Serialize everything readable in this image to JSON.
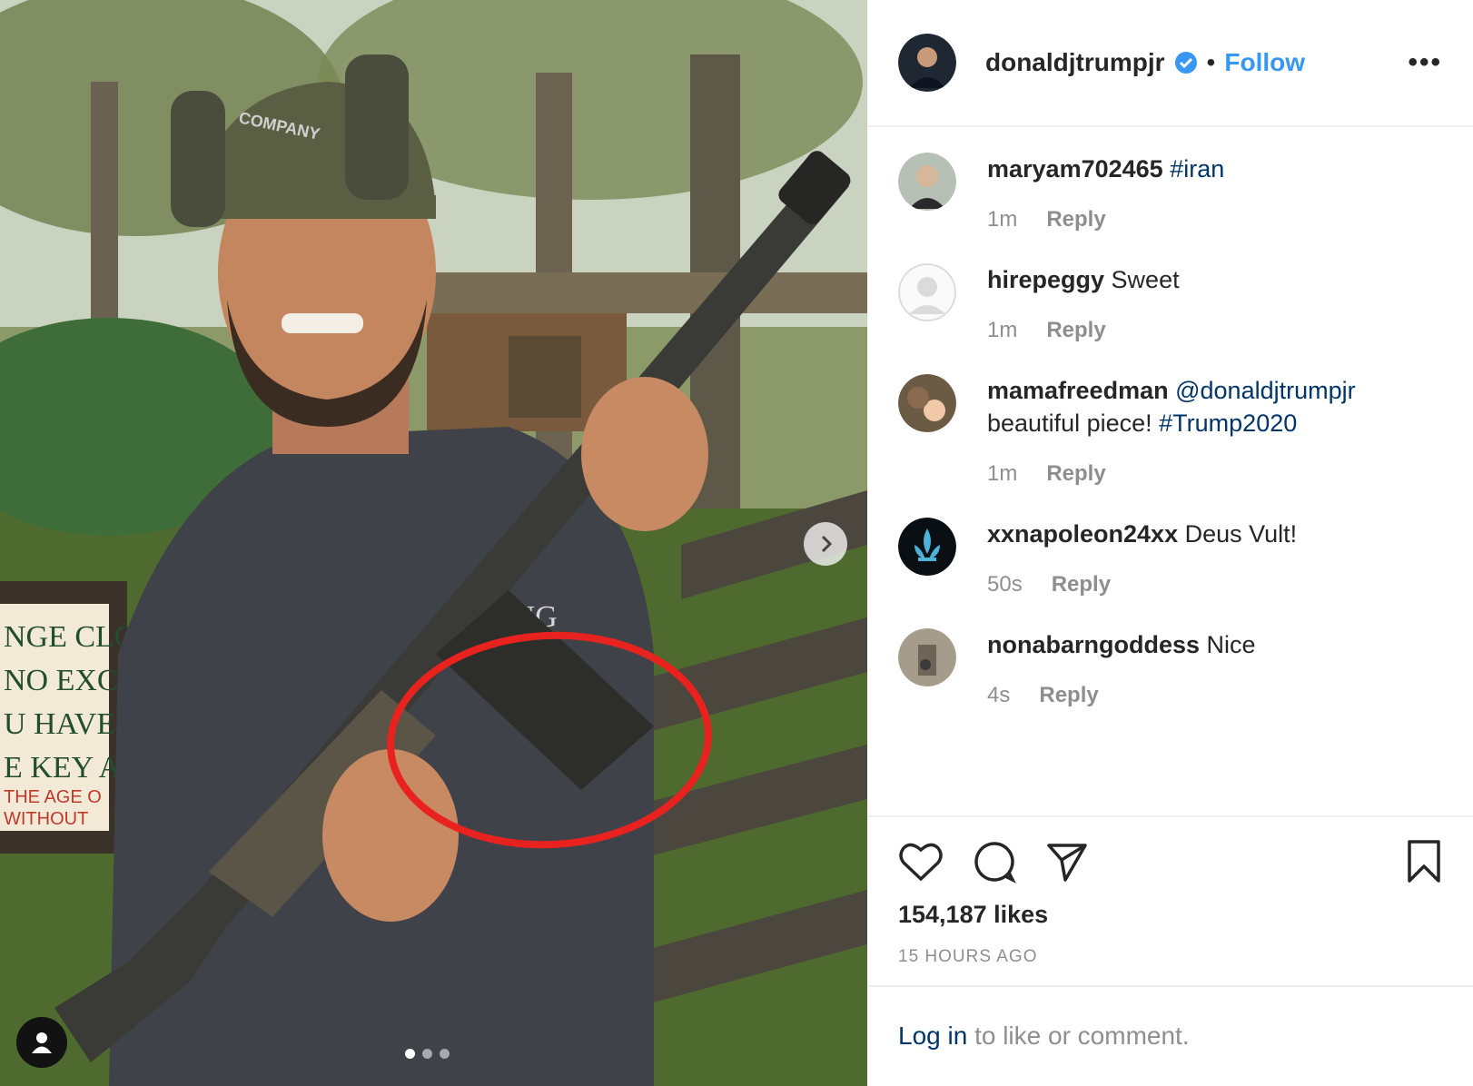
{
  "post": {
    "author": "donaldjtrumpjr",
    "separator": "•",
    "follow_label": "Follow",
    "more_label": "•••",
    "carousel_count": 3,
    "carousel_active": 1,
    "sign_text": [
      "NGE CLO",
      "NO EXC",
      "U HAVE",
      "E KEY A",
      "THE AGE O",
      "WITHOUT"
    ],
    "shirt_text": "ONG",
    "cap_text": "COMPANY"
  },
  "comments": [
    {
      "user": "maryam702465",
      "text": "",
      "link": "#iran",
      "time": "1m",
      "reply": "Reply"
    },
    {
      "user": "hirepeggy",
      "text": "Sweet",
      "link": "",
      "time": "1m",
      "reply": "Reply"
    },
    {
      "user": "mamafreedman",
      "link": "@donaldjtrumpjr",
      "text2": "beautiful piece!",
      "link2": "#Trump2020",
      "time": "1m",
      "reply": "Reply"
    },
    {
      "user": "xxnapoleon24xx",
      "text": "Deus Vult!",
      "link": "",
      "time": "50s",
      "reply": "Reply"
    },
    {
      "user": "nonabarngoddess",
      "text": "Nice",
      "link": "",
      "time": "4s",
      "reply": "Reply"
    }
  ],
  "engagement": {
    "likes": "154,187 likes",
    "posted": "15 HOURS AGO"
  },
  "login": {
    "link": "Log in",
    "text": "to like or comment."
  },
  "colors": {
    "accent": "#3897f0",
    "link": "#003569",
    "annotation": "#e8231f"
  }
}
